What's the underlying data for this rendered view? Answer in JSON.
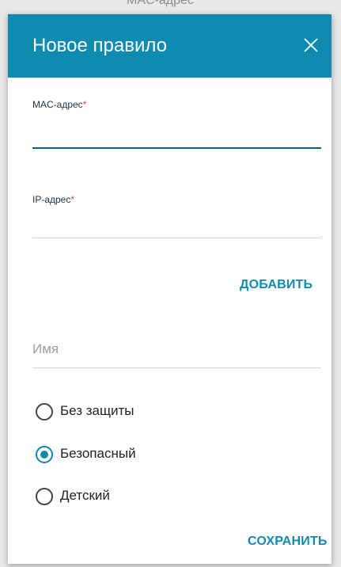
{
  "backdrop": {
    "text": "MAC-адрес"
  },
  "dialog": {
    "title": "Новое правило",
    "close_icon": "close-icon"
  },
  "form": {
    "mac": {
      "label": "MAC-адрес",
      "required_mark": "*",
      "value": ""
    },
    "ip": {
      "label": "IP-адрес",
      "required_mark": "*",
      "value": ""
    },
    "add_label": "ДОБАВИТЬ",
    "name": {
      "placeholder": "Имя",
      "value": ""
    },
    "security": {
      "options": [
        {
          "label": "Без защиты",
          "checked": false
        },
        {
          "label": "Безопасный",
          "checked": true
        },
        {
          "label": "Детский",
          "checked": false
        }
      ]
    },
    "save_label": "СОХРАНИТЬ"
  },
  "colors": {
    "accent": "#0f8bb1",
    "required": "#e53935",
    "active_underline": "#0f5f88"
  }
}
